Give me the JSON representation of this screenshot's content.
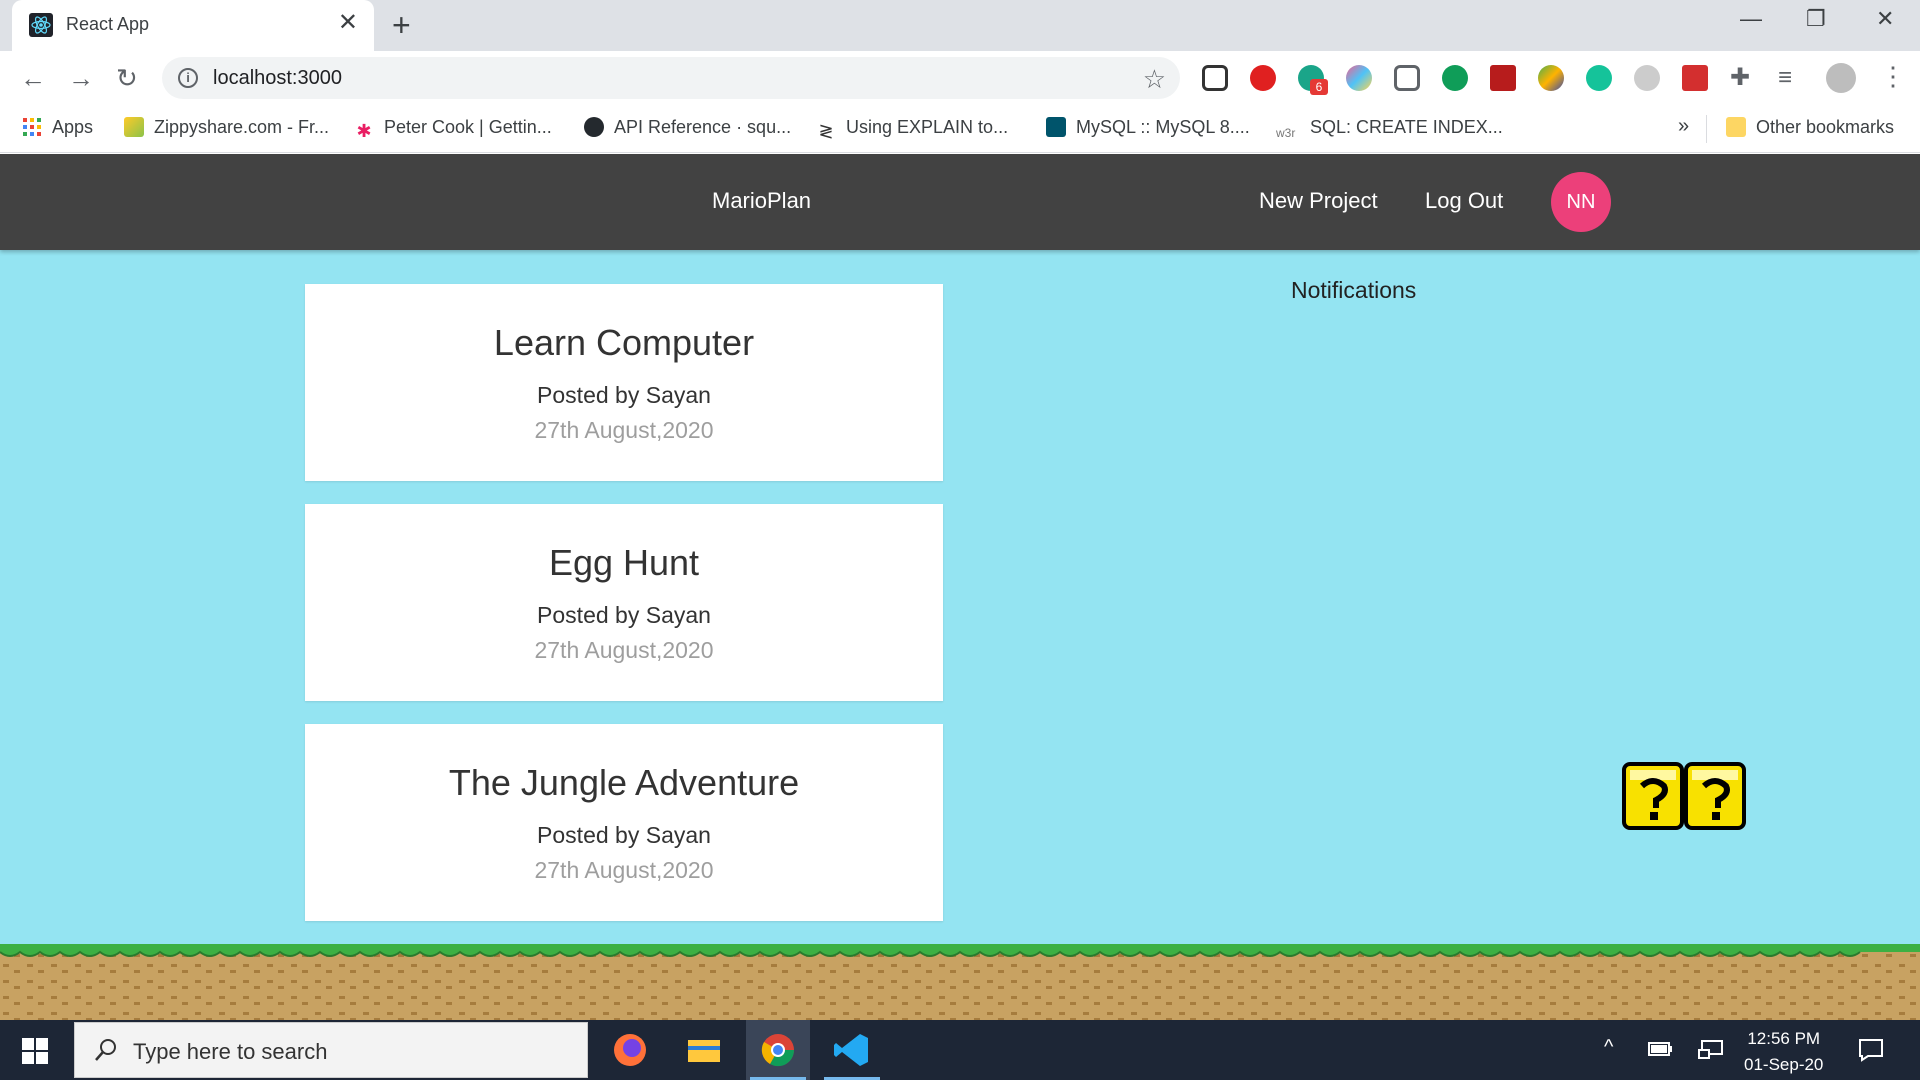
{
  "browser": {
    "tab_title": "React App",
    "url": "localhost:3000",
    "window_controls": {
      "minimize": "—",
      "restore": "❐",
      "close": "✕"
    },
    "new_tab": "+",
    "extension_badge": "6",
    "bookmarks": [
      {
        "label": "Apps",
        "icon": "apps-grid-icon"
      },
      {
        "label": "Zippyshare.com - Fr...",
        "icon": "zippyshare-icon"
      },
      {
        "label": "Peter Cook | Gettin...",
        "icon": "peter-cook-icon"
      },
      {
        "label": "API Reference · squ...",
        "icon": "github-icon"
      },
      {
        "label": "Using EXPLAIN to...",
        "icon": "explain-icon"
      },
      {
        "label": "MySQL :: MySQL 8....",
        "icon": "mysql-icon"
      },
      {
        "label": "SQL: CREATE INDEX...",
        "icon": "w3r-icon"
      }
    ],
    "bookmarks_overflow": "»",
    "other_bookmarks": "Other bookmarks",
    "w3r_prefix": "w3r"
  },
  "app": {
    "brand": "MarioPlan",
    "nav": {
      "new_project": "New Project",
      "log_out": "Log Out",
      "avatar_initials": "NN"
    },
    "projects": [
      {
        "title": "Learn Computer",
        "posted_by": "Posted by Sayan",
        "date": "27th August,2020"
      },
      {
        "title": "Egg Hunt",
        "posted_by": "Posted by Sayan",
        "date": "27th August,2020"
      },
      {
        "title": "The Jungle Adventure",
        "posted_by": "Posted by Sayan",
        "date": "27th August,2020"
      }
    ],
    "notifications_title": "Notifications",
    "colors": {
      "navbar": "#424242",
      "background": "#94e4f2",
      "avatar": "#ec407a"
    }
  },
  "taskbar": {
    "search_placeholder": "Type here to search",
    "time": "12:56 PM",
    "date": "01-Sep-20",
    "tray_chevron": "^"
  }
}
